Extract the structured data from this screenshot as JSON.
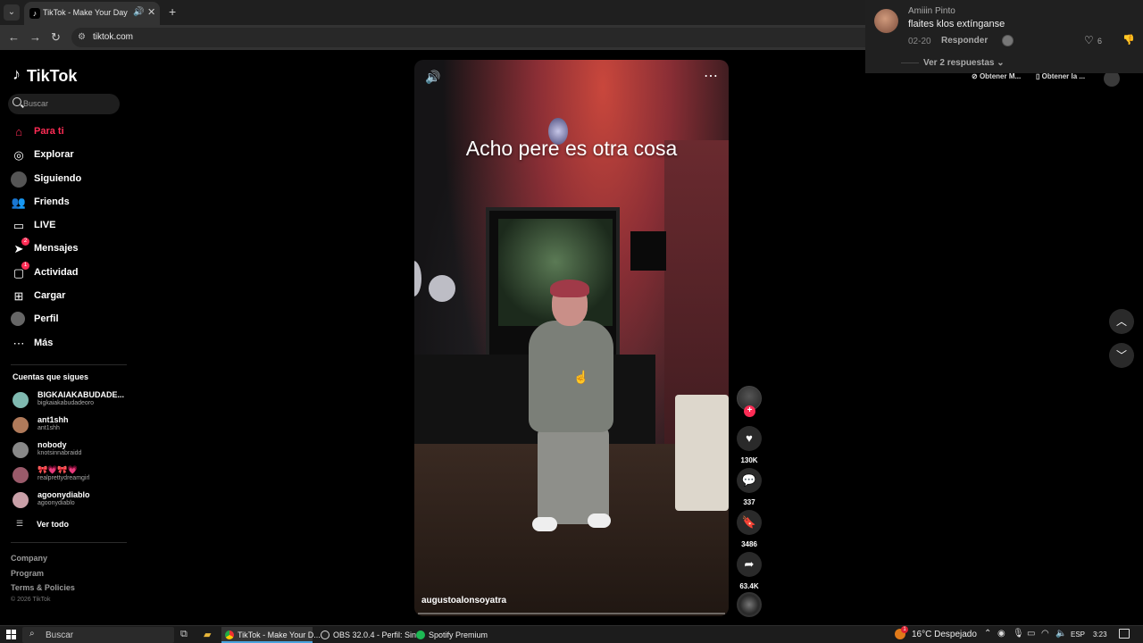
{
  "browser": {
    "tab_title": "TikTok - Make Your Day",
    "url": "tiktok.com",
    "tab_list_icon": "chevron-down-icon",
    "icons": {
      "back": "arrow-left-icon",
      "forward": "arrow-right-icon",
      "reload": "reload-icon"
    }
  },
  "sidebar": {
    "logo": "TikTok",
    "search_placeholder": "Buscar",
    "nav": [
      {
        "label": "Para ti",
        "icon": "home-icon",
        "active": true
      },
      {
        "label": "Explorar",
        "icon": "compass-icon"
      },
      {
        "label": "Siguiendo",
        "icon": "avatar-icon"
      },
      {
        "label": "Friends",
        "icon": "friends-icon"
      },
      {
        "label": "LIVE",
        "icon": "live-icon"
      },
      {
        "label": "Mensajes",
        "icon": "send-icon",
        "badge": "2"
      },
      {
        "label": "Actividad",
        "icon": "inbox-icon",
        "badge": "1"
      },
      {
        "label": "Cargar",
        "icon": "plus-square-icon"
      },
      {
        "label": "Perfil",
        "icon": "profile-icon"
      },
      {
        "label": "Más",
        "icon": "more-icon"
      }
    ],
    "following_title": "Cuentas que sigues",
    "accounts": [
      {
        "name": "BIGKAIAKABUDADE...",
        "handle": "bigkaiakabudadeoro"
      },
      {
        "name": "ant1shh",
        "handle": "ant1shh"
      },
      {
        "name": "nobody",
        "handle": "knotsinnabraidd"
      },
      {
        "name": "🎀💗🎀💗",
        "handle": "realprettydreamgirl"
      },
      {
        "name": "agoonydiablo",
        "handle": "agoonydiablo"
      }
    ],
    "see_all": "Ver todo",
    "footer": [
      "Company",
      "Program",
      "Terms & Policies"
    ],
    "copyright": "© 2026 TikTok"
  },
  "video": {
    "caption": "Acho pere es otra cosa",
    "author": "augustoalonsoyatra",
    "progress": 0.0
  },
  "actions": {
    "likes": "130K",
    "comments": "337",
    "saves": "3486",
    "shares": "63.4K"
  },
  "notification": {
    "name": "Amiiin Pinto",
    "text": "flaites klos extínganse",
    "date": "02-20",
    "reply": "Responder",
    "likes": "6",
    "more_replies": "Ver 2 respuestas"
  },
  "top_buttons": [
    "Obtener M...",
    "Obtener la ..."
  ],
  "taskbar": {
    "search_placeholder": "Buscar",
    "apps": [
      "TikTok - Make Your D...",
      "OBS 32.0.4 - Perfil: Sin...",
      "Spotify Premium"
    ],
    "weather": "16°C  Despejado",
    "weather_badge": "1",
    "lang": "ESP",
    "time": "3:23"
  },
  "colors": {
    "accent": "#fe2c55",
    "background": "#000000"
  }
}
